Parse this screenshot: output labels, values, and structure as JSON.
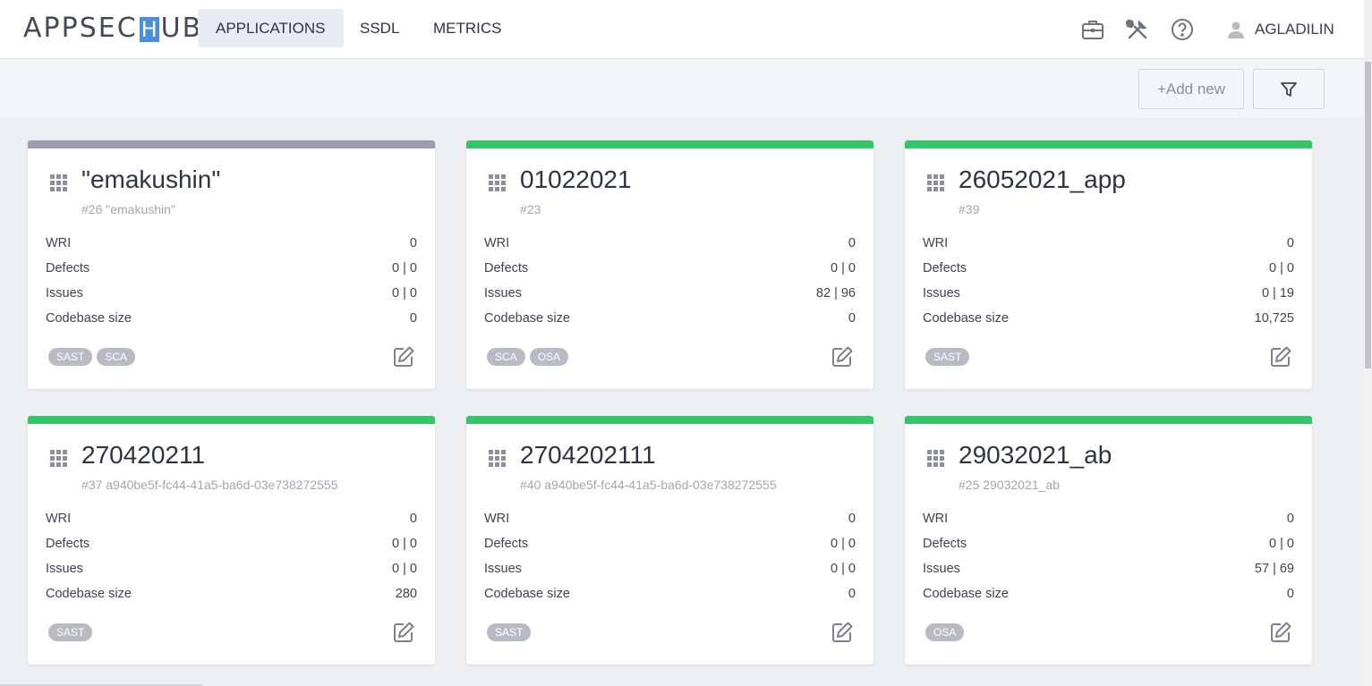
{
  "header": {
    "logo_prefix": "APPSEC",
    "logo_h": "H",
    "logo_suffix": "UB",
    "tabs": [
      {
        "label": "APPLICATIONS",
        "active": true
      },
      {
        "label": "SSDL",
        "active": false
      },
      {
        "label": "METRICS",
        "active": false
      }
    ],
    "icons": [
      "briefcase-icon",
      "tools-icon",
      "help-icon"
    ],
    "username": "AGLADILIN"
  },
  "toolbar": {
    "add_label": "+Add new",
    "filter_icon": "filter-icon"
  },
  "colors": {
    "status_green": "#34c76a",
    "status_gray": "#9c9eae",
    "tag_bg": "#b9bbc4",
    "active_tab_bg": "#e7ecf5"
  },
  "metric_labels": {
    "wri": "WRI",
    "defects": "Defects",
    "issues": "Issues",
    "codebase": "Codebase size"
  },
  "cards": [
    {
      "title": "\"emakushin\"",
      "subtitle": "#26 \"emakushin\"",
      "status": "gray",
      "wri": "0",
      "defects": "0 | 0",
      "issues": "0 | 0",
      "codebase": "0",
      "tags": [
        "SAST",
        "SCA"
      ]
    },
    {
      "title": "01022021",
      "subtitle": "#23",
      "status": "green",
      "wri": "0",
      "defects": "0 | 0",
      "issues": "82 | 96",
      "codebase": "0",
      "tags": [
        "SCA",
        "OSA"
      ]
    },
    {
      "title": "26052021_app",
      "subtitle": "#39",
      "status": "green",
      "wri": "0",
      "defects": "0 | 0",
      "issues": "0 | 19",
      "codebase": "10,725",
      "tags": [
        "SAST"
      ]
    },
    {
      "title": "270420211",
      "subtitle": "#37 a940be5f-fc44-41a5-ba6d-03e738272555",
      "status": "green",
      "wri": "0",
      "defects": "0 | 0",
      "issues": "0 | 0",
      "codebase": "280",
      "tags": [
        "SAST"
      ]
    },
    {
      "title": "2704202111",
      "subtitle": "#40 a940be5f-fc44-41a5-ba6d-03e738272555",
      "status": "green",
      "wri": "0",
      "defects": "0 | 0",
      "issues": "0 | 0",
      "codebase": "0",
      "tags": [
        "SAST"
      ]
    },
    {
      "title": "29032021_ab",
      "subtitle": "#25 29032021_ab",
      "status": "green",
      "wri": "0",
      "defects": "0 | 0",
      "issues": "57 | 69",
      "codebase": "0",
      "tags": [
        "OSA"
      ]
    }
  ]
}
